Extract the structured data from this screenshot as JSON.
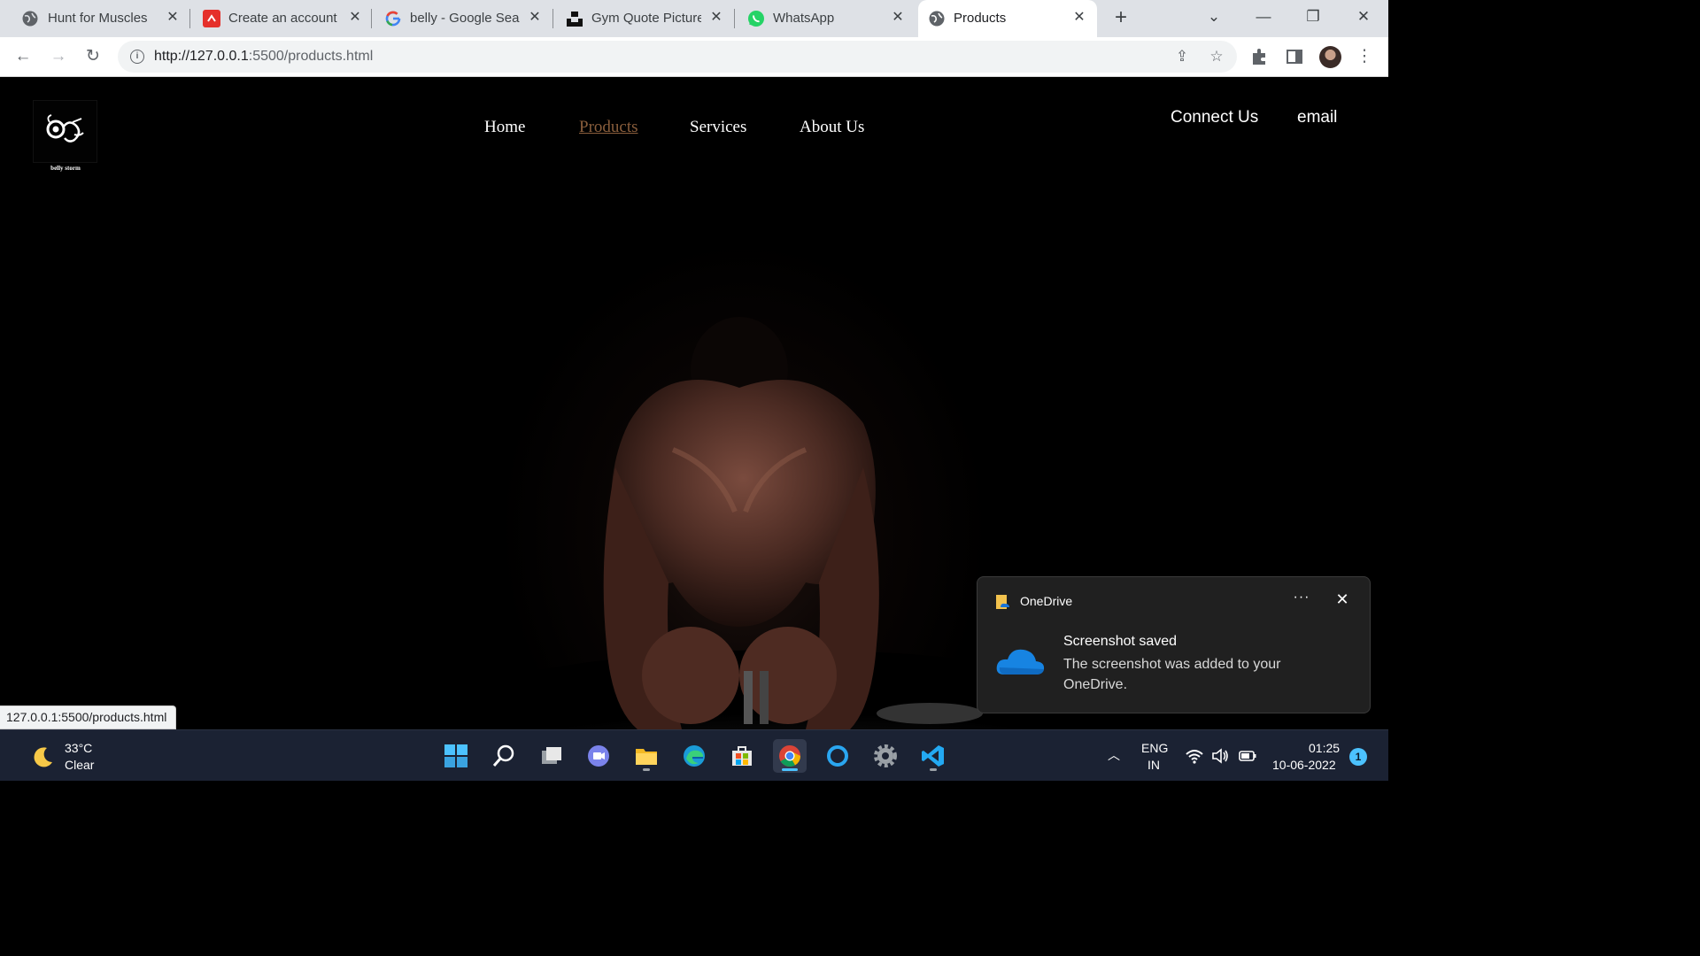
{
  "browser": {
    "tabs": [
      {
        "title": "Hunt for Muscles",
        "icon": "globe-icon"
      },
      {
        "title": "Create an account |",
        "icon": "red-app-icon"
      },
      {
        "title": "belly - Google Sear",
        "icon": "google-icon"
      },
      {
        "title": "Gym Quote Picture",
        "icon": "unsplash-icon"
      },
      {
        "title": "WhatsApp",
        "icon": "whatsapp-icon"
      },
      {
        "title": "Products",
        "icon": "globe-icon",
        "active": true
      }
    ],
    "new_tab_label": "+",
    "url_host": "http://127.0.0.1",
    "url_rest": ":5500/products.html",
    "status_url": "127.0.0.1:5500/products.html"
  },
  "site": {
    "logo_caption": "belly storm",
    "nav": [
      {
        "label": "Home",
        "active": false
      },
      {
        "label": "Products",
        "active": true
      },
      {
        "label": "Services",
        "active": false
      },
      {
        "label": "About Us",
        "active": false
      }
    ],
    "connect_label": "Connect Us",
    "email_label": "email",
    "active_link_color": "#8a5e3c"
  },
  "toast": {
    "app": "OneDrive",
    "more": "···",
    "close": "✕",
    "title": "Screenshot saved",
    "body": "The screenshot was added to your OneDrive."
  },
  "taskbar": {
    "temperature": "33°C",
    "condition": "Clear",
    "lang_line1": "ENG",
    "lang_line2": "IN",
    "time": "01:25",
    "date": "10-06-2022",
    "notification_count": "1",
    "accent": "#4cc2ff"
  }
}
